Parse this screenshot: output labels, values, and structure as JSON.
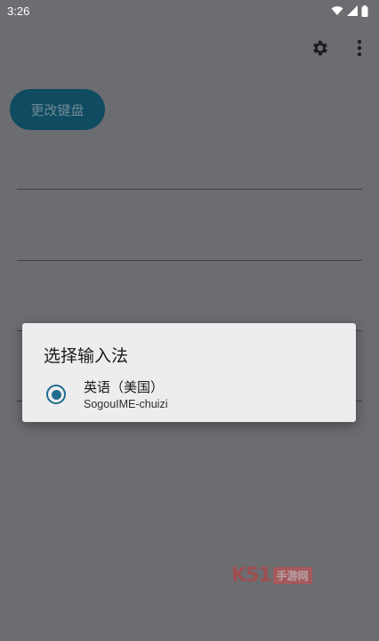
{
  "status_bar": {
    "time": "3:26"
  },
  "toolbar": {
    "settings_icon": "gear-icon",
    "more_icon": "more-vert-icon"
  },
  "main": {
    "change_keyboard_label": "更改键盘"
  },
  "dialog": {
    "title": "选择输入法",
    "options": [
      {
        "label": "英语（美国）",
        "subtitle": "SogouIME-chuizi",
        "selected": true
      }
    ]
  },
  "watermark": {
    "text": "K51",
    "badge": "手游网"
  },
  "colors": {
    "accent": "#1f6c8c",
    "button_bg": "#0f4b61",
    "scrim": "#6c6d70",
    "dialog_bg": "#ededef"
  }
}
